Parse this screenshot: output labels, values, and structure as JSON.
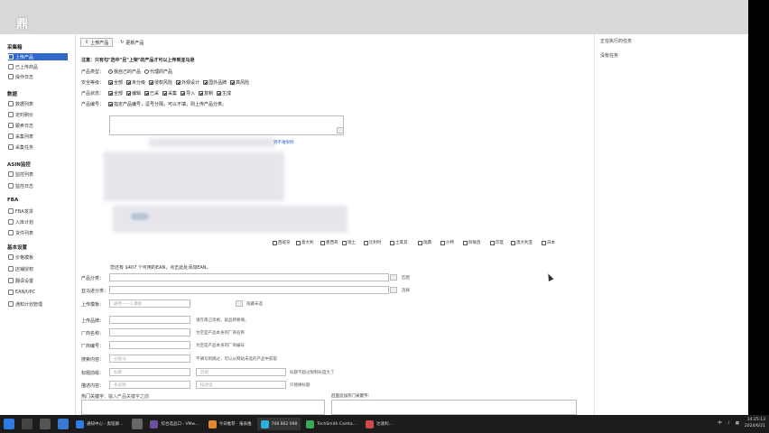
{
  "app": {
    "title_logo": "鼎",
    "colors": {
      "accent": "#2f68c9",
      "taskbar": "#1c1c1c"
    }
  },
  "sidebar": {
    "sections": [
      {
        "label": "采集箱",
        "items": [
          {
            "label": "上传产品",
            "icon": "upload-icon",
            "active": true
          },
          {
            "label": "已上传商品",
            "icon": "list-icon",
            "active": false
          },
          {
            "label": "操作日志",
            "icon": "log-icon",
            "active": false
          }
        ]
      },
      {
        "label": "数据",
        "items": [
          {
            "label": "数据列表",
            "icon": "table-icon",
            "active": false
          },
          {
            "label": "定时刷价",
            "icon": "clock-icon",
            "active": false
          },
          {
            "label": "跟卖日志",
            "icon": "doc-icon",
            "active": false
          },
          {
            "label": "采集列表",
            "icon": "list-icon",
            "active": false
          },
          {
            "label": "采集任务",
            "icon": "task-icon",
            "active": false
          }
        ]
      },
      {
        "label": "ASIN监控",
        "items": [
          {
            "label": "监控列表",
            "icon": "monitor-icon",
            "active": false
          },
          {
            "label": "监控日志",
            "icon": "log-icon",
            "active": false
          }
        ]
      },
      {
        "label": "FBA",
        "items": [
          {
            "label": "FBA发货",
            "icon": "ship-icon",
            "active": false
          },
          {
            "label": "入库计划",
            "icon": "plan-icon",
            "active": false
          },
          {
            "label": "货件列表",
            "icon": "box-icon",
            "active": false
          }
        ]
      },
      {
        "label": "基本设置",
        "items": [
          {
            "label": "价格模板",
            "icon": "template-icon",
            "active": false
          },
          {
            "label": "店铺授权",
            "icon": "shop-icon",
            "active": false
          },
          {
            "label": "翻译设置",
            "icon": "translate-icon",
            "active": false
          },
          {
            "label": "EAN/UPC",
            "icon": "barcode-icon",
            "active": false
          },
          {
            "label": "通知计划管理",
            "icon": "bell-icon",
            "active": false
          }
        ]
      }
    ]
  },
  "main": {
    "tabs": [
      {
        "label": "上传产品",
        "icon": "upload-icon"
      },
      {
        "label": "更新产品",
        "icon": "refresh-icon"
      }
    ],
    "notice": "注意：只有勾\"选中\"且\"上架\"的产品才可以上传到亚马逊",
    "product_type": {
      "label": "产品类型：",
      "options": [
        {
          "label": "我自己的产品",
          "checked": true
        },
        {
          "label": "代理的产品",
          "checked": false
        }
      ]
    },
    "safety": {
      "label": "安全等级：",
      "options": [
        {
          "label": "全部",
          "checked": true
        },
        {
          "label": "未分级",
          "checked": true
        },
        {
          "label": "侵权风险",
          "checked": true
        },
        {
          "label": "外观设计",
          "checked": true
        },
        {
          "label": "国外品牌",
          "checked": true
        },
        {
          "label": "高风险",
          "checked": true
        }
      ]
    },
    "product_status": {
      "label": "产品状态：",
      "options": [
        {
          "label": "全部",
          "checked": true
        },
        {
          "label": "编辑",
          "checked": true
        },
        {
          "label": "已采",
          "checked": true
        },
        {
          "label": "采集",
          "checked": true
        },
        {
          "label": "导入",
          "checked": true
        },
        {
          "label": "复制",
          "checked": true
        },
        {
          "label": "生成",
          "checked": true
        }
      ]
    },
    "product_code": {
      "label": "产品编号：",
      "option": "指定产品编号，逗号分隔，可以不填，则上传产品分类。"
    },
    "limit_link": "到不难限制",
    "countries": [
      "西班牙",
      "意大利",
      "墨西哥",
      "瑞士",
      "比利时",
      "土耳其",
      "瑞典",
      "沙特",
      "阿联酋",
      "印度",
      "澳大利亚",
      "日本"
    ],
    "ean_note": "您还有 $407 个可用的EAN，点击此处添加EAN。",
    "category": {
      "label": "产品分类：",
      "btn": "匹配"
    },
    "amazon_category": {
      "label": "亚马逊分类：",
      "btn": "选择"
    },
    "upload_template": {
      "label": "上传模板：",
      "placeholder": "通用——1 模板",
      "hide_btn": "隐藏未选"
    },
    "brand": {
      "label": "上传品牌：",
      "note": "请在南己资格，就品牌要填。"
    },
    "maker": {
      "label": "厂商名称：",
      "note": "为空是产品本身的厂商名称"
    },
    "maker_no": {
      "label": "厂商编号：",
      "note": "为空是产品本身的厂商编号"
    },
    "search_content": {
      "label": "搜索内容：",
      "placeholder": "分类词",
      "note": "不填写则跳过，可以从网站未选的产品中获取"
    },
    "title_prefix": {
      "label": "标题前缀：",
      "placeholder1": "标题",
      "placeholder2": "后缀",
      "note": "标题不超过限制长度大了"
    },
    "desc_content": {
      "label": "描述内容：",
      "placeholder1": "多说明",
      "placeholder2": "描述说",
      "note": "只替换标题"
    },
    "hot_keywords": {
      "label": "热门关键字：",
      "placeholder": "输入产品关键字之前",
      "right_label": "后面追加热门关键字："
    }
  },
  "rightpanel": {
    "header": "正在执行的任务",
    "task_label": "没有任务"
  },
  "taskbar": {
    "apps": [
      {
        "label": "通知中心 - 奥钮群…",
        "color": "#2d7be0"
      },
      {
        "label": "综合选品口 - VMw…",
        "color": "#6b4f9f"
      },
      {
        "label": "今日推荐 - 报表推",
        "color": "#e08a2d"
      },
      {
        "label": "708 862 098",
        "color": "#2db0e0"
      },
      {
        "label": "TechSmith Camta…",
        "color": "#3aa85a"
      },
      {
        "label": "达速利…",
        "color": "#d04a4a"
      }
    ],
    "tray_text": "中",
    "time": "14:25:13",
    "date": "2024/6/21"
  }
}
